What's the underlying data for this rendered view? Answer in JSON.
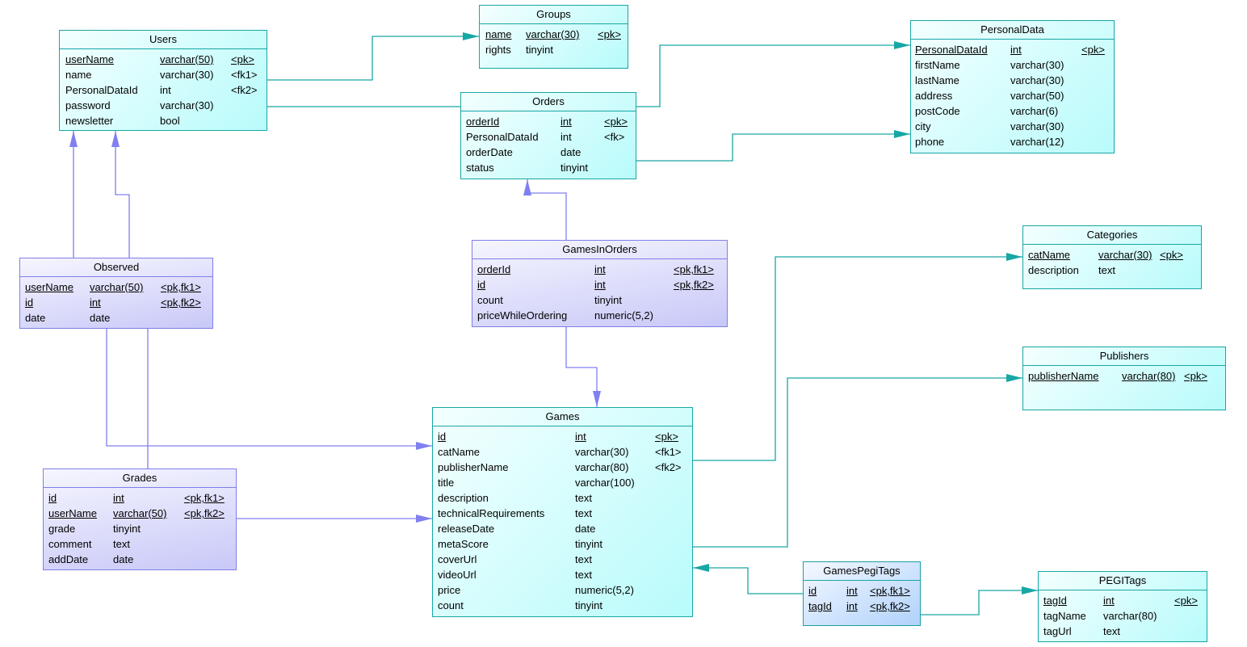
{
  "diagram": {
    "type": "physical-data-model",
    "entities": {
      "users": {
        "name": "Users",
        "columns": [
          {
            "name": "userName",
            "type": "varchar(50)",
            "key": "<pk>",
            "pk": true
          },
          {
            "name": "name",
            "type": "varchar(30)",
            "key": "<fk1>",
            "pk": false
          },
          {
            "name": "PersonalDataId",
            "type": "int",
            "key": "<fk2>",
            "pk": false
          },
          {
            "name": "password",
            "type": "varchar(30)",
            "key": "",
            "pk": false
          },
          {
            "name": "newsletter",
            "type": "bool",
            "key": "",
            "pk": false
          }
        ]
      },
      "groups": {
        "name": "Groups",
        "columns": [
          {
            "name": "name",
            "type": "varchar(30)",
            "key": "<pk>",
            "pk": true
          },
          {
            "name": "rights",
            "type": "tinyint",
            "key": "",
            "pk": false
          }
        ]
      },
      "personaldata": {
        "name": "PersonalData",
        "columns": [
          {
            "name": "PersonalDataId",
            "type": "int",
            "key": "<pk>",
            "pk": true
          },
          {
            "name": "firstName",
            "type": "varchar(30)",
            "key": "",
            "pk": false
          },
          {
            "name": "lastName",
            "type": "varchar(30)",
            "key": "",
            "pk": false
          },
          {
            "name": "address",
            "type": "varchar(50)",
            "key": "",
            "pk": false
          },
          {
            "name": "postCode",
            "type": "varchar(6)",
            "key": "",
            "pk": false
          },
          {
            "name": "city",
            "type": "varchar(30)",
            "key": "",
            "pk": false
          },
          {
            "name": "phone",
            "type": "varchar(12)",
            "key": "",
            "pk": false
          }
        ]
      },
      "orders": {
        "name": "Orders",
        "columns": [
          {
            "name": "orderId",
            "type": "int",
            "key": "<pk>",
            "pk": true
          },
          {
            "name": "PersonalDataId",
            "type": "int",
            "key": "<fk>",
            "pk": false
          },
          {
            "name": "orderDate",
            "type": "date",
            "key": "",
            "pk": false
          },
          {
            "name": "status",
            "type": "tinyint",
            "key": "",
            "pk": false
          }
        ]
      },
      "observed": {
        "name": "Observed",
        "columns": [
          {
            "name": "userName",
            "type": "varchar(50)",
            "key": "<pk,fk1>",
            "pk": true
          },
          {
            "name": "id",
            "type": "int",
            "key": "<pk,fk2>",
            "pk": true
          },
          {
            "name": "date",
            "type": "date",
            "key": "",
            "pk": false
          }
        ]
      },
      "gamesinorders": {
        "name": "GamesInOrders",
        "columns": [
          {
            "name": "orderId",
            "type": "int",
            "key": "<pk,fk1>",
            "pk": true
          },
          {
            "name": "id",
            "type": "int",
            "key": "<pk,fk2>",
            "pk": true
          },
          {
            "name": "count",
            "type": "tinyint",
            "key": "",
            "pk": false
          },
          {
            "name": "priceWhileOrdering",
            "type": "numeric(5,2)",
            "key": "",
            "pk": false
          }
        ]
      },
      "categories": {
        "name": "Categories",
        "columns": [
          {
            "name": "catName",
            "type": "varchar(30)",
            "key": "<pk>",
            "pk": true
          },
          {
            "name": "description",
            "type": "text",
            "key": "",
            "pk": false
          }
        ]
      },
      "publishers": {
        "name": "Publishers",
        "columns": [
          {
            "name": "publisherName",
            "type": "varchar(80)",
            "key": "<pk>",
            "pk": true
          }
        ]
      },
      "games": {
        "name": "Games",
        "columns": [
          {
            "name": "id",
            "type": "int",
            "key": "<pk>",
            "pk": true
          },
          {
            "name": "catName",
            "type": "varchar(30)",
            "key": "<fk1>",
            "pk": false
          },
          {
            "name": "publisherName",
            "type": "varchar(80)",
            "key": "<fk2>",
            "pk": false
          },
          {
            "name": "title",
            "type": "varchar(100)",
            "key": "",
            "pk": false
          },
          {
            "name": "description",
            "type": "text",
            "key": "",
            "pk": false
          },
          {
            "name": "technicalRequirements",
            "type": "text",
            "key": "",
            "pk": false
          },
          {
            "name": "releaseDate",
            "type": "date",
            "key": "",
            "pk": false
          },
          {
            "name": "metaScore",
            "type": "tinyint",
            "key": "",
            "pk": false
          },
          {
            "name": "coverUrl",
            "type": "text",
            "key": "",
            "pk": false
          },
          {
            "name": "videoUrl",
            "type": "text",
            "key": "",
            "pk": false
          },
          {
            "name": "price",
            "type": "numeric(5,2)",
            "key": "",
            "pk": false
          },
          {
            "name": "count",
            "type": "tinyint",
            "key": "",
            "pk": false
          }
        ]
      },
      "grades": {
        "name": "Grades",
        "columns": [
          {
            "name": "id",
            "type": "int",
            "key": "<pk,fk1>",
            "pk": true
          },
          {
            "name": "userName",
            "type": "varchar(50)",
            "key": "<pk,fk2>",
            "pk": true
          },
          {
            "name": "grade",
            "type": "tinyint",
            "key": "",
            "pk": false
          },
          {
            "name": "comment",
            "type": "text",
            "key": "",
            "pk": false
          },
          {
            "name": "addDate",
            "type": "date",
            "key": "",
            "pk": false
          }
        ]
      },
      "gamespegitags": {
        "name": "GamesPegiTags",
        "columns": [
          {
            "name": "id",
            "type": "int",
            "key": "<pk,fk1>",
            "pk": true
          },
          {
            "name": "tagId",
            "type": "int",
            "key": "<pk,fk2>",
            "pk": true
          }
        ]
      },
      "pegitags": {
        "name": "PEGITags",
        "columns": [
          {
            "name": "tagId",
            "type": "int",
            "key": "<pk>",
            "pk": true
          },
          {
            "name": "tagName",
            "type": "varchar(80)",
            "key": "",
            "pk": false
          },
          {
            "name": "tagUrl",
            "type": "text",
            "key": "",
            "pk": false
          }
        ]
      }
    },
    "relationships": [
      {
        "from": "Users",
        "to": "Groups"
      },
      {
        "from": "Users",
        "to": "Orders"
      },
      {
        "from": "Orders",
        "to": "PersonalData"
      },
      {
        "from": "Orders",
        "to": "PersonalData"
      },
      {
        "from": "Observed",
        "to": "Users"
      },
      {
        "from": "Grades",
        "to": "Users"
      },
      {
        "from": "GamesInOrders",
        "to": "Orders"
      },
      {
        "from": "GamesInOrders",
        "to": "Games"
      },
      {
        "from": "Observed",
        "to": "Games"
      },
      {
        "from": "Grades",
        "to": "Games"
      },
      {
        "from": "Games",
        "to": "Categories"
      },
      {
        "from": "Games",
        "to": "Publishers"
      },
      {
        "from": "GamesPegiTags",
        "to": "Games"
      },
      {
        "from": "GamesPegiTags",
        "to": "PEGITags"
      }
    ],
    "colors": {
      "teal_line": "#17a7a5",
      "violet_line": "#8080f0",
      "teal_fill": "#b8fbfb",
      "violet_fill": "#c8c8f8",
      "blue_fill": "#b0d2fb"
    }
  }
}
